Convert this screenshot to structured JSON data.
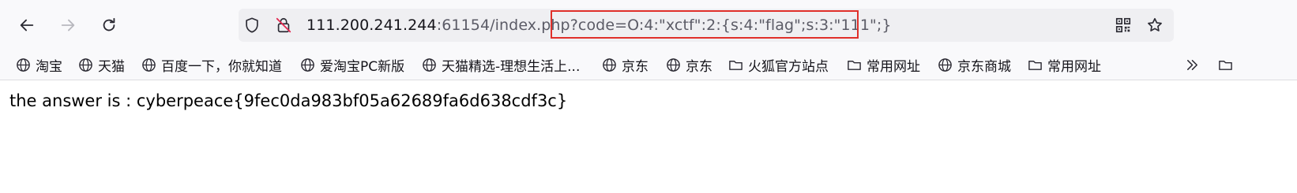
{
  "browser": {
    "nav": {
      "back_icon": "arrow-left-icon",
      "forward_icon": "arrow-right-icon",
      "reload_icon": "reload-icon"
    },
    "url": {
      "host": "111.200.241.244",
      "rest": ":61154/index.php?code=O:4:\"xctf\":2:{s:4:\"flag\";s:3:\"111\";}",
      "highlight_color": "#e0302a"
    },
    "icons": {
      "shield": "shield-icon",
      "insecure": "insecure-lock-icon",
      "qr": "qr-code-icon",
      "star": "bookmark-star-icon"
    }
  },
  "bookmarks": [
    {
      "label": "淘宝",
      "icon": "globe-icon"
    },
    {
      "label": "天猫",
      "icon": "globe-icon"
    },
    {
      "label": "百度一下，你就知道",
      "icon": "globe-icon"
    },
    {
      "label": "爱淘宝PC新版",
      "icon": "globe-icon"
    },
    {
      "label": "天猫精选-理想生活上...",
      "icon": "globe-icon"
    },
    {
      "label": "京东",
      "icon": "globe-icon"
    },
    {
      "label": "京东",
      "icon": "globe-icon"
    },
    {
      "label": "火狐官方站点",
      "icon": "folder-icon"
    },
    {
      "label": "常用网址",
      "icon": "folder-icon"
    },
    {
      "label": "京东商城",
      "icon": "globe-icon"
    },
    {
      "label": "常用网址",
      "icon": "folder-icon"
    }
  ],
  "page": {
    "text": "the answer is : cyberpeace{9fec0da983bf05a62689fa6d638cdf3c}"
  }
}
